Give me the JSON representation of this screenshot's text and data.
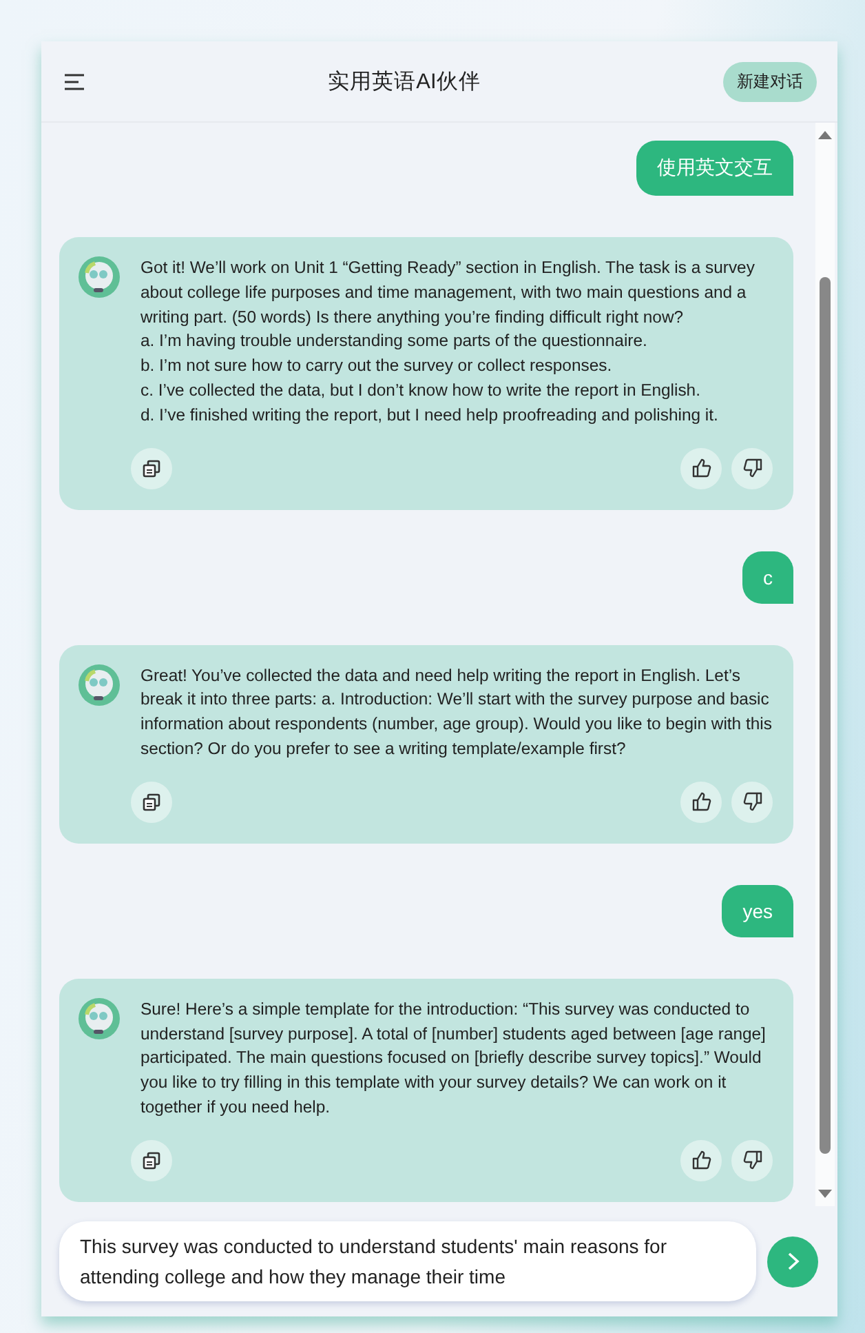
{
  "header": {
    "title": "实用英语AI伙伴",
    "new_chat_button": "新建对话"
  },
  "messages": [
    {
      "kind": "user",
      "text": "使用英文交互"
    },
    {
      "kind": "bot",
      "paragraphs": [
        "Got it! We’ll work on Unit 1 “Getting Ready” section in English. The task is a survey about college life purposes and time management, with two main questions and a writing part. (50 words) Is there anything you’re finding difficult right now?",
        "a. I’m having trouble understanding some parts of the questionnaire.",
        "b. I’m not sure how to carry out the survey or collect responses.",
        "c. I’ve collected the data, but I don’t know how to write the report in English.",
        "d. I’ve finished writing the report, but I need help proofreading and polishing it."
      ]
    },
    {
      "kind": "user",
      "text": "c"
    },
    {
      "kind": "bot",
      "paragraphs": [
        "Great! You’ve collected the data and need help writing the report in English. Let’s break it into three parts: a. Introduction: We’ll start with the survey purpose and basic information about respondents (number, age group). Would you like to begin with this section? Or do you prefer to see a writing template/example first?"
      ]
    },
    {
      "kind": "user",
      "text": "yes"
    },
    {
      "kind": "bot",
      "paragraphs": [
        "Sure! Here’s a simple template for the introduction: “This survey was conducted to understand [survey purpose]. A total of [number] students aged between [age range] participated. The main questions focused on [briefly describe survey topics].” Would you like to try filling in this template with your survey details? We can work on it together if you need help."
      ]
    }
  ],
  "input": {
    "value": "This survey was conducted to understand students' main reasons for attending college and how they manage their time"
  }
}
